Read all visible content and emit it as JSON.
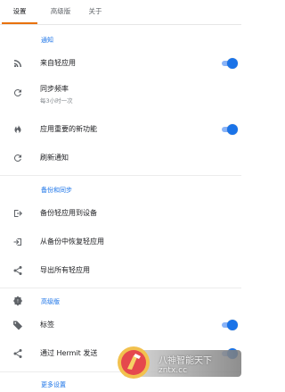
{
  "tabs": [
    {
      "label": "设置"
    },
    {
      "label": "高级版"
    },
    {
      "label": "关于"
    }
  ],
  "sections": {
    "notify": {
      "header": "通知",
      "rows": [
        {
          "label": "来自轻应用",
          "toggle": true,
          "icon": "rss-feed-icon"
        },
        {
          "label": "同步频率",
          "sub": "每3小时一次",
          "icon": "refresh-icon"
        },
        {
          "label": "应用重要的新功能",
          "toggle": true,
          "icon": "flame-icon"
        },
        {
          "label": "刷新通知",
          "icon": "refresh-icon"
        }
      ]
    },
    "backup": {
      "header": "备份和同步",
      "rows": [
        {
          "label": "备份轻应用到设备",
          "icon": "export-icon"
        },
        {
          "label": "从备份中恢复轻应用",
          "icon": "import-icon"
        },
        {
          "label": "导出所有轻应用",
          "icon": "share-icon"
        }
      ]
    },
    "premium": {
      "header": "高级版",
      "rows": [
        {
          "label": "标签",
          "toggle": true,
          "icon": "tag-icon"
        },
        {
          "label": "通过 Hermit 发送",
          "toggle": true,
          "icon": "share-icon"
        }
      ],
      "badge_icon": "premium-badge-icon"
    },
    "more": {
      "header": "更多设置"
    }
  },
  "watermark": {
    "line1": "八神智能天下",
    "line2": "zntx.cc"
  },
  "colors": {
    "accent_blue": "#1a73e8",
    "tab_indicator": "#e8710a",
    "icon_gray": "#5f6368"
  }
}
